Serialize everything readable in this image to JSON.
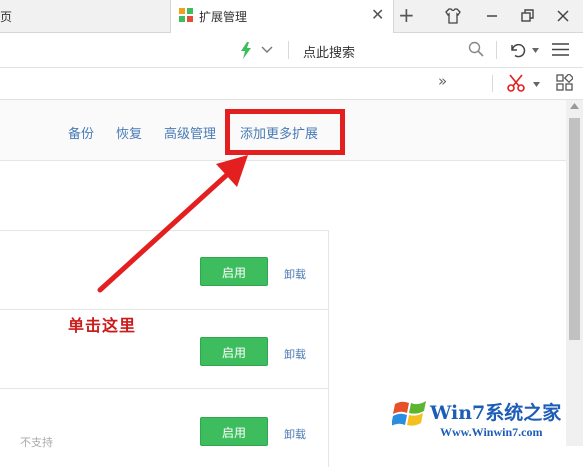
{
  "tabs": {
    "previous_tab_label": "页",
    "active_tab_label": "扩展管理"
  },
  "toolbar": {
    "search_label": "点此搜索"
  },
  "bookmarks": {
    "more_label": "»"
  },
  "extension_header": {
    "links": [
      "备份",
      "恢复",
      "高级管理",
      "添加更多扩展"
    ]
  },
  "extensions": [
    {
      "enable_label": "启用",
      "uninstall_label": "卸载"
    },
    {
      "enable_label": "启用",
      "uninstall_label": "卸载"
    },
    {
      "enable_label": "启用",
      "uninstall_label": "卸载"
    }
  ],
  "footer_partial_text": "不支持",
  "annotation": {
    "text": "单击这里",
    "color": "#e31f1f"
  },
  "watermark": {
    "logo_text": "Win7系统之家",
    "url": "Www.Winwin7.com"
  },
  "colors": {
    "accent_link": "#4a7bb5",
    "enable_green": "#3dbd5d"
  }
}
